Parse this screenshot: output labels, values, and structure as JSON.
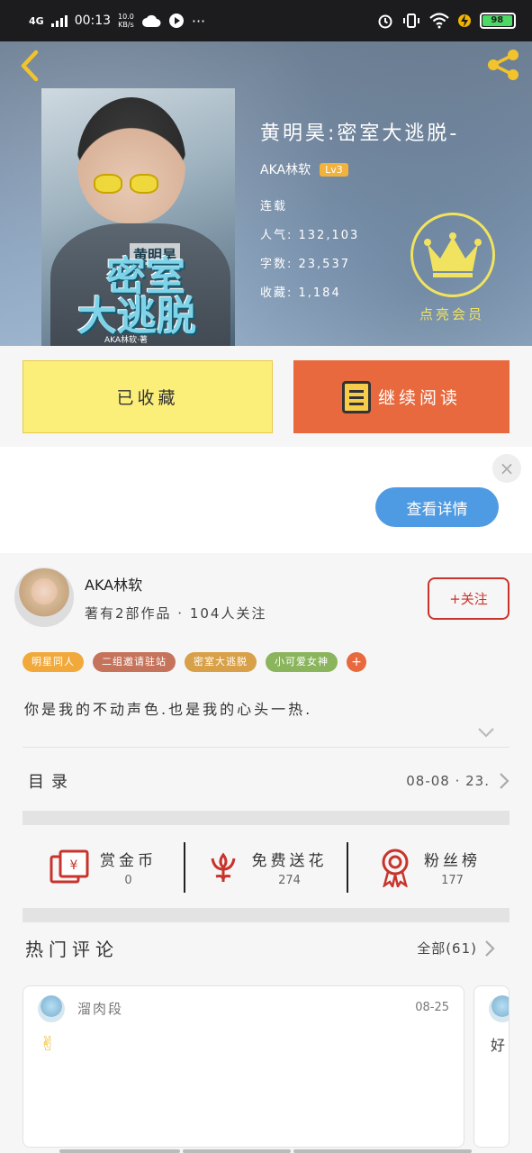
{
  "status_bar": {
    "network": "4G",
    "time": "00:13",
    "speed_value": "10.0",
    "speed_unit": "KB/s",
    "dots": "···",
    "battery": "98"
  },
  "book": {
    "title": "黄明昊:密室大逃脱-",
    "author": "AKA林软",
    "level": "Lv3",
    "status": "连载",
    "popularity": "人气: 132,103",
    "word_count": "字数: 23,537",
    "favorites": "收藏: 1,184",
    "vip_label": "点亮会员",
    "cover_text": {
      "small": "黄明昊",
      "line1": "密室",
      "line2": "大逃脱",
      "byline": "AKA林软·著"
    }
  },
  "actions": {
    "favorited_label": "已收藏",
    "continue_label": "继续阅读"
  },
  "ad": {
    "close_glyph": "×",
    "details_label": "查看详情"
  },
  "author_section": {
    "name": "AKA林软",
    "meta": "著有2部作品 · 104人关注",
    "follow_label": "+关注",
    "tags": [
      {
        "label": "明星同人",
        "color": "#f2a93b"
      },
      {
        "label": "二组邀请驻站",
        "color": "#c6735c"
      },
      {
        "label": "密室大逃脱",
        "color": "#d8a048"
      },
      {
        "label": "小可爱女神",
        "color": "#8ab55c"
      }
    ],
    "tags_more": "+",
    "description": "你是我的不动声色.也是我的心头一热.",
    "toc_title": "目录",
    "toc_update": "08-08 · 23."
  },
  "rewards": [
    {
      "label": "赏金币",
      "value": "0",
      "icon": "red-envelope-icon"
    },
    {
      "label": "免费送花",
      "value": "274",
      "icon": "flower-icon"
    },
    {
      "label": "粉丝榜",
      "value": "177",
      "icon": "medal-icon"
    }
  ],
  "comments": {
    "title": "热门评论",
    "all_label": "全部(61)",
    "items": [
      {
        "user": "溜肉段",
        "date": "08-25",
        "body": "✌"
      },
      {
        "user": "",
        "date": "",
        "body": "好"
      }
    ]
  },
  "colors": {
    "accent_orange": "#e8693d",
    "fav_yellow": "#fbef7a",
    "follow_red": "#c8342c",
    "detail_blue": "#4f9be3",
    "vip_yellow": "#f1e35f"
  }
}
